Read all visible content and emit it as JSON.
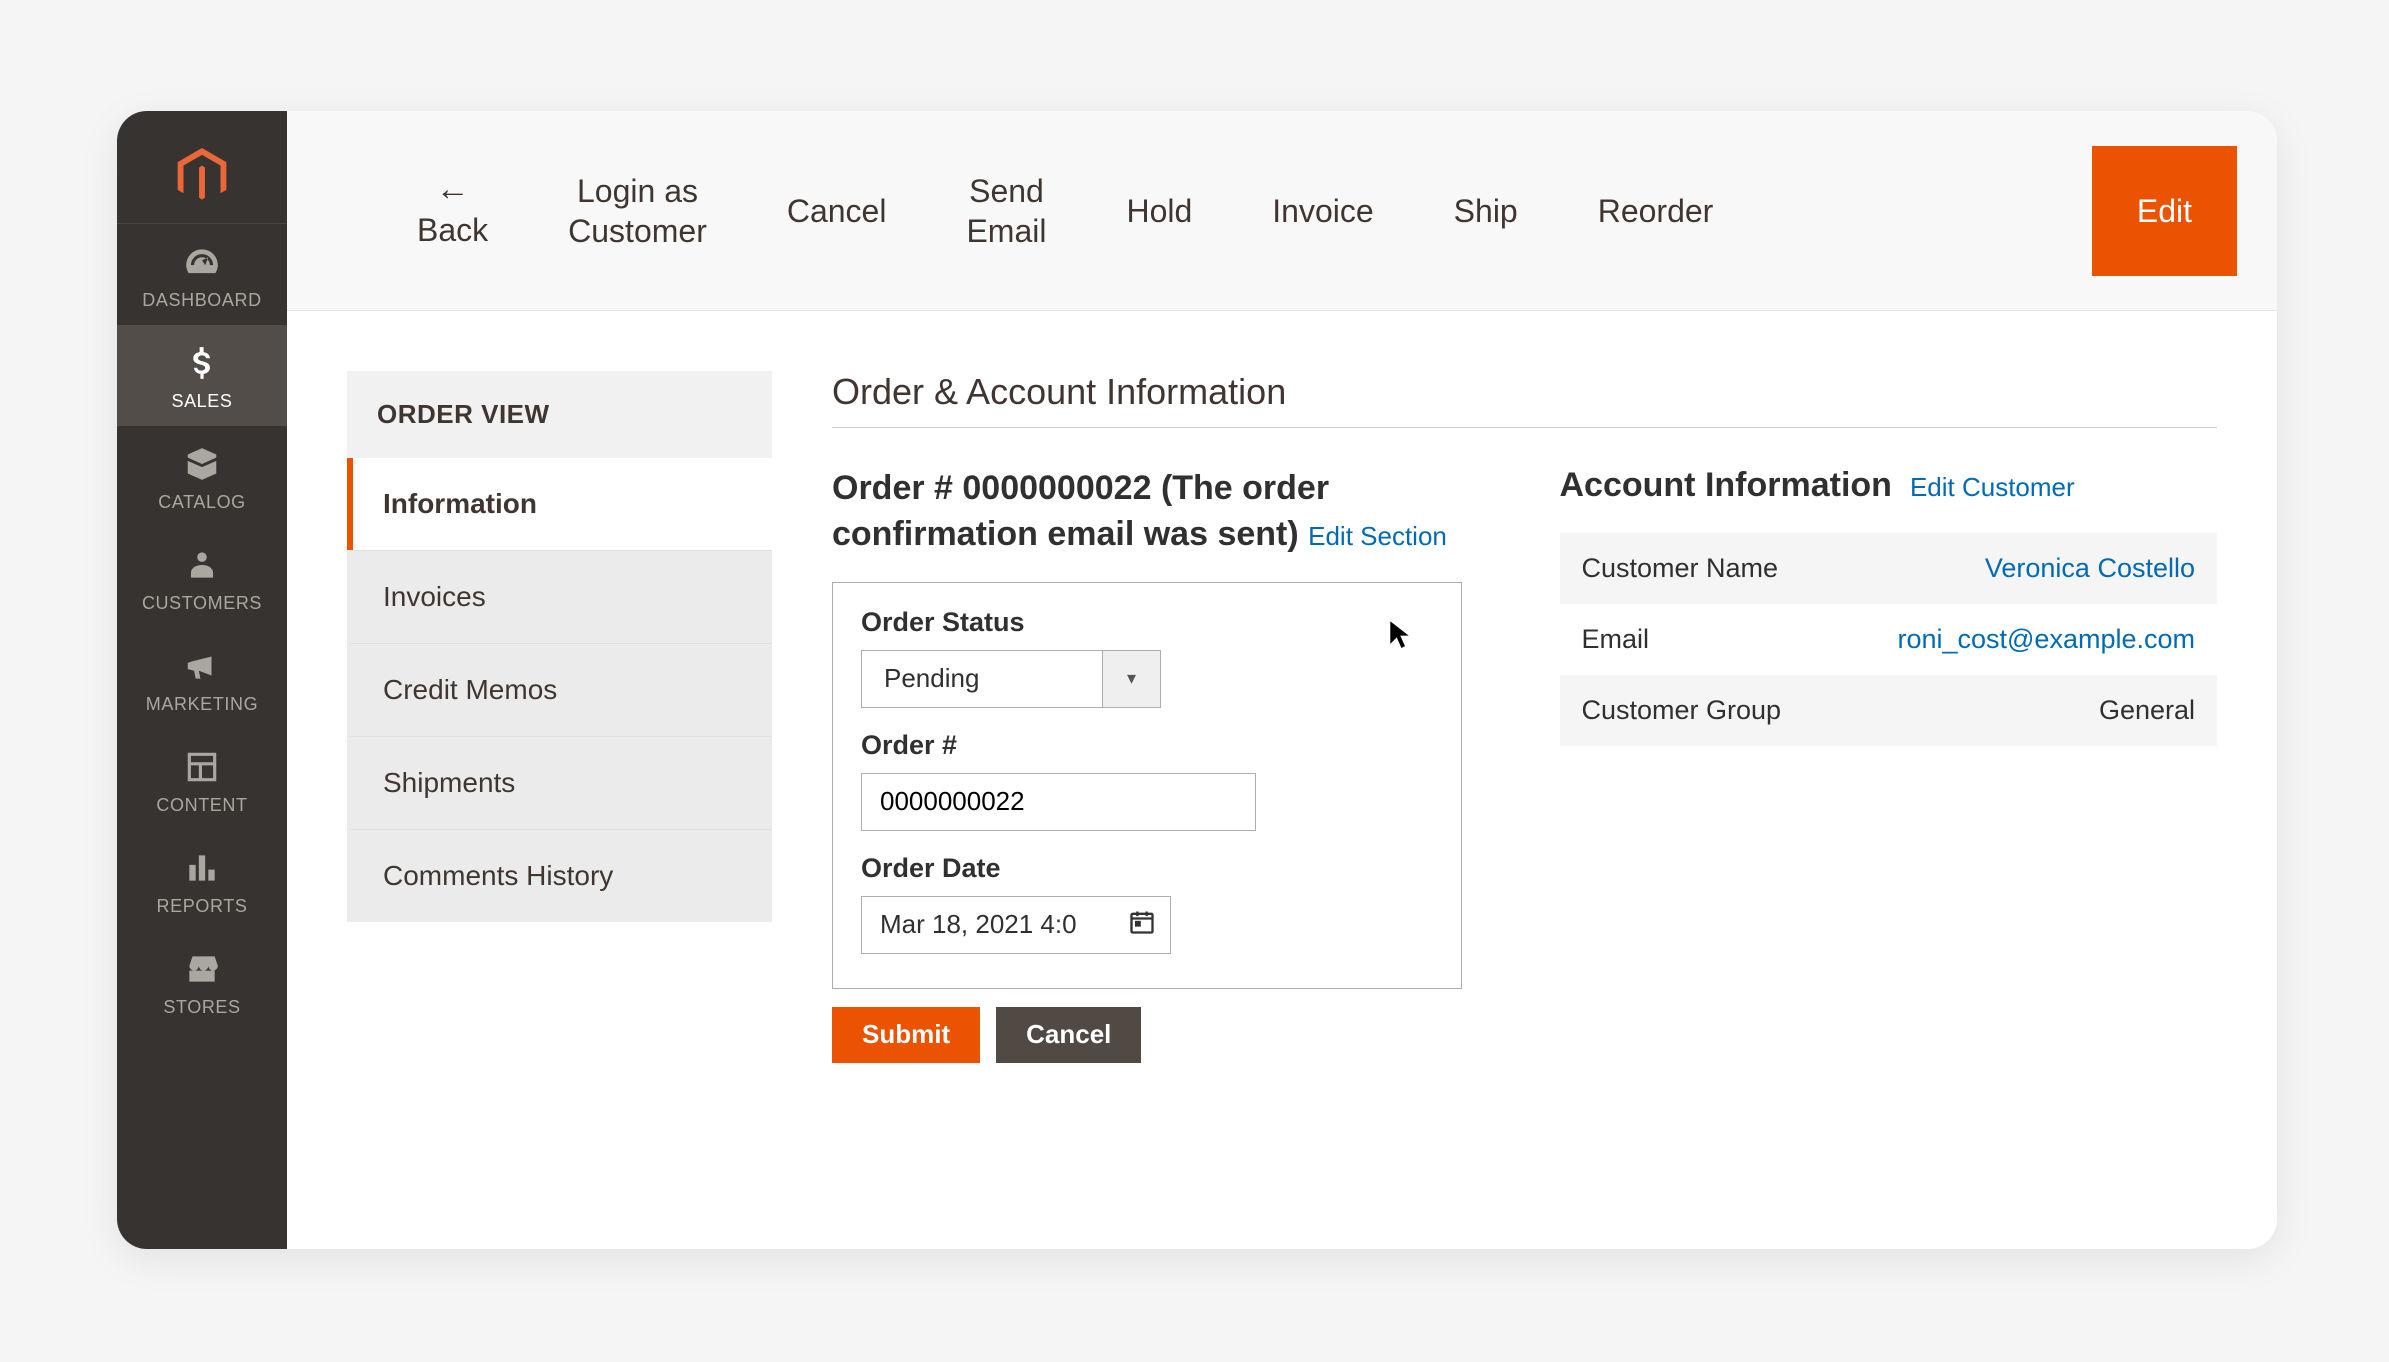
{
  "sidebar": {
    "items": [
      {
        "label": "DASHBOARD"
      },
      {
        "label": "SALES"
      },
      {
        "label": "CATALOG"
      },
      {
        "label": "CUSTOMERS"
      },
      {
        "label": "MARKETING"
      },
      {
        "label": "CONTENT"
      },
      {
        "label": "REPORTS"
      },
      {
        "label": "STORES"
      }
    ]
  },
  "toolbar": {
    "back": "Back",
    "login_as_customer": "Login as\nCustomer",
    "cancel": "Cancel",
    "send_email": "Send\nEmail",
    "hold": "Hold",
    "invoice": "Invoice",
    "ship": "Ship",
    "reorder": "Reorder",
    "edit": "Edit"
  },
  "order_view": {
    "title": "ORDER VIEW",
    "tabs": [
      "Information",
      "Invoices",
      "Credit Memos",
      "Shipments",
      "Comments History"
    ]
  },
  "main": {
    "section_title": "Order & Account Information",
    "order_title_number": "Order # 0000000022",
    "order_title_note": "(The order confirmation email was sent)",
    "edit_section_link": "Edit Section",
    "fields": {
      "order_status_label": "Order Status",
      "order_status_value": "Pending",
      "order_number_label": "Order #",
      "order_number_value": "0000000022",
      "order_date_label": "Order Date",
      "order_date_value": "Mar 18, 2021 4:0"
    },
    "submit_label": "Submit",
    "cancel_label": "Cancel"
  },
  "account": {
    "heading": "Account Information",
    "edit_link": "Edit Customer",
    "rows": [
      {
        "label": "Customer Name",
        "value": "Veronica Costello",
        "link": true
      },
      {
        "label": "Email",
        "value": "roni_cost@example.com",
        "link": true
      },
      {
        "label": "Customer Group",
        "value": "General",
        "link": false
      }
    ]
  }
}
